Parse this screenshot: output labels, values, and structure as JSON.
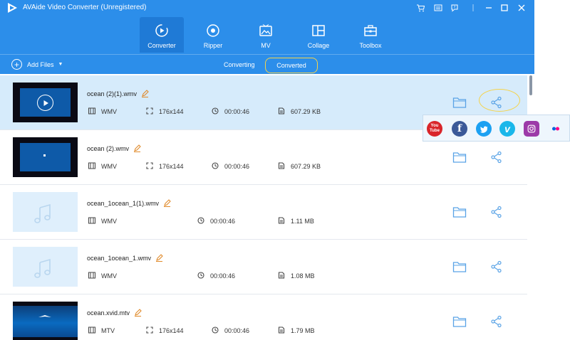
{
  "window": {
    "title": "AVAide Video Converter (Unregistered)",
    "controls": [
      "cart-icon",
      "menu-icon",
      "help-icon",
      "minimize-icon",
      "maximize-icon",
      "close-icon"
    ]
  },
  "nav": {
    "tabs": [
      {
        "label": "Converter",
        "icon": "converter-icon",
        "active": true
      },
      {
        "label": "Ripper",
        "icon": "ripper-icon",
        "active": false
      },
      {
        "label": "MV",
        "icon": "mv-icon",
        "active": false
      },
      {
        "label": "Collage",
        "icon": "collage-icon",
        "active": false
      },
      {
        "label": "Toolbox",
        "icon": "toolbox-icon",
        "active": false
      }
    ]
  },
  "subbar": {
    "add_files": "Add Files",
    "tab_converting": "Converting",
    "tab_converted": "Converted"
  },
  "files": [
    {
      "name": "ocean (2)(1).wmv",
      "format": "WMV",
      "resolution": "176x144",
      "duration": "00:00:46",
      "size": "607.29 KB",
      "thumb": "video-playing"
    },
    {
      "name": "ocean (2).wmv",
      "format": "WMV",
      "resolution": "176x144",
      "duration": "00:00:46",
      "size": "607.29 KB",
      "thumb": "video"
    },
    {
      "name": "ocean_1ocean_1(1).wmv",
      "format": "WMV",
      "resolution": "",
      "duration": "00:00:46",
      "size": "1.11 MB",
      "thumb": "audio"
    },
    {
      "name": "ocean_1ocean_1.wmv",
      "format": "WMV",
      "resolution": "",
      "duration": "00:00:46",
      "size": "1.08 MB",
      "thumb": "audio"
    },
    {
      "name": "ocean.xvid.mtv",
      "format": "MTV",
      "resolution": "176x144",
      "duration": "00:00:46",
      "size": "1.79 MB",
      "thumb": "video-sea"
    }
  ],
  "share_popup": {
    "youtube_label": "You Tube",
    "targets": [
      "youtube-icon",
      "facebook-icon",
      "twitter-icon",
      "vimeo-icon",
      "instagram-icon",
      "flickr-icon"
    ]
  },
  "colors": {
    "topbar": "#2c8eea",
    "active_tab": "#1f7ad6",
    "highlight": "#f5d34a",
    "selected_row": "#d6ebfb",
    "icon_blue": "#5aa3e6"
  }
}
